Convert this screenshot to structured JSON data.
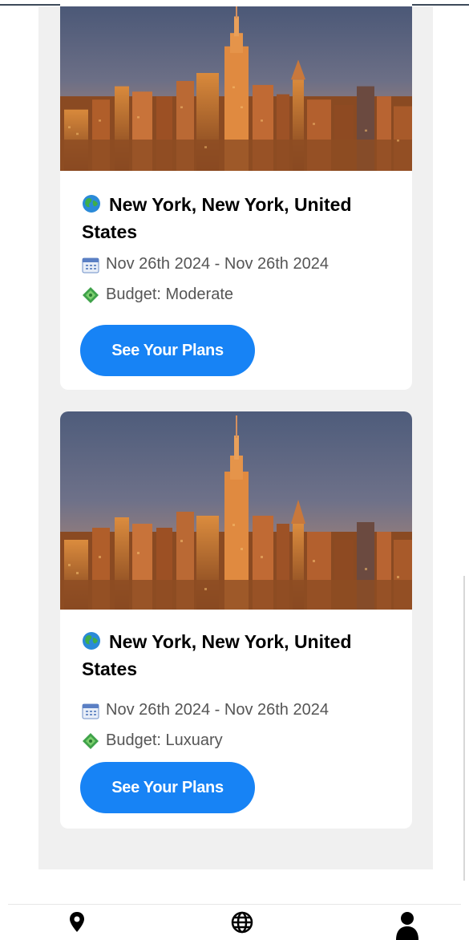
{
  "trips": [
    {
      "location": "New York, New York, United States",
      "dates": "Nov 26th 2024 - Nov 26th 2024",
      "budget": "Budget: Moderate",
      "button_label": "See Your Plans"
    },
    {
      "location": "New York, New York, United States",
      "dates": "Nov 26th 2024 - Nov 26th 2024",
      "budget": "Budget: Luxuary",
      "button_label": "See Your Plans"
    }
  ],
  "bottom_nav": {
    "items": [
      {
        "icon": "location-pin-icon"
      },
      {
        "icon": "globe-icon"
      },
      {
        "icon": "user-icon"
      }
    ]
  },
  "colors": {
    "accent": "#1783f5",
    "background": "#f0f0f0",
    "card": "#ffffff"
  }
}
